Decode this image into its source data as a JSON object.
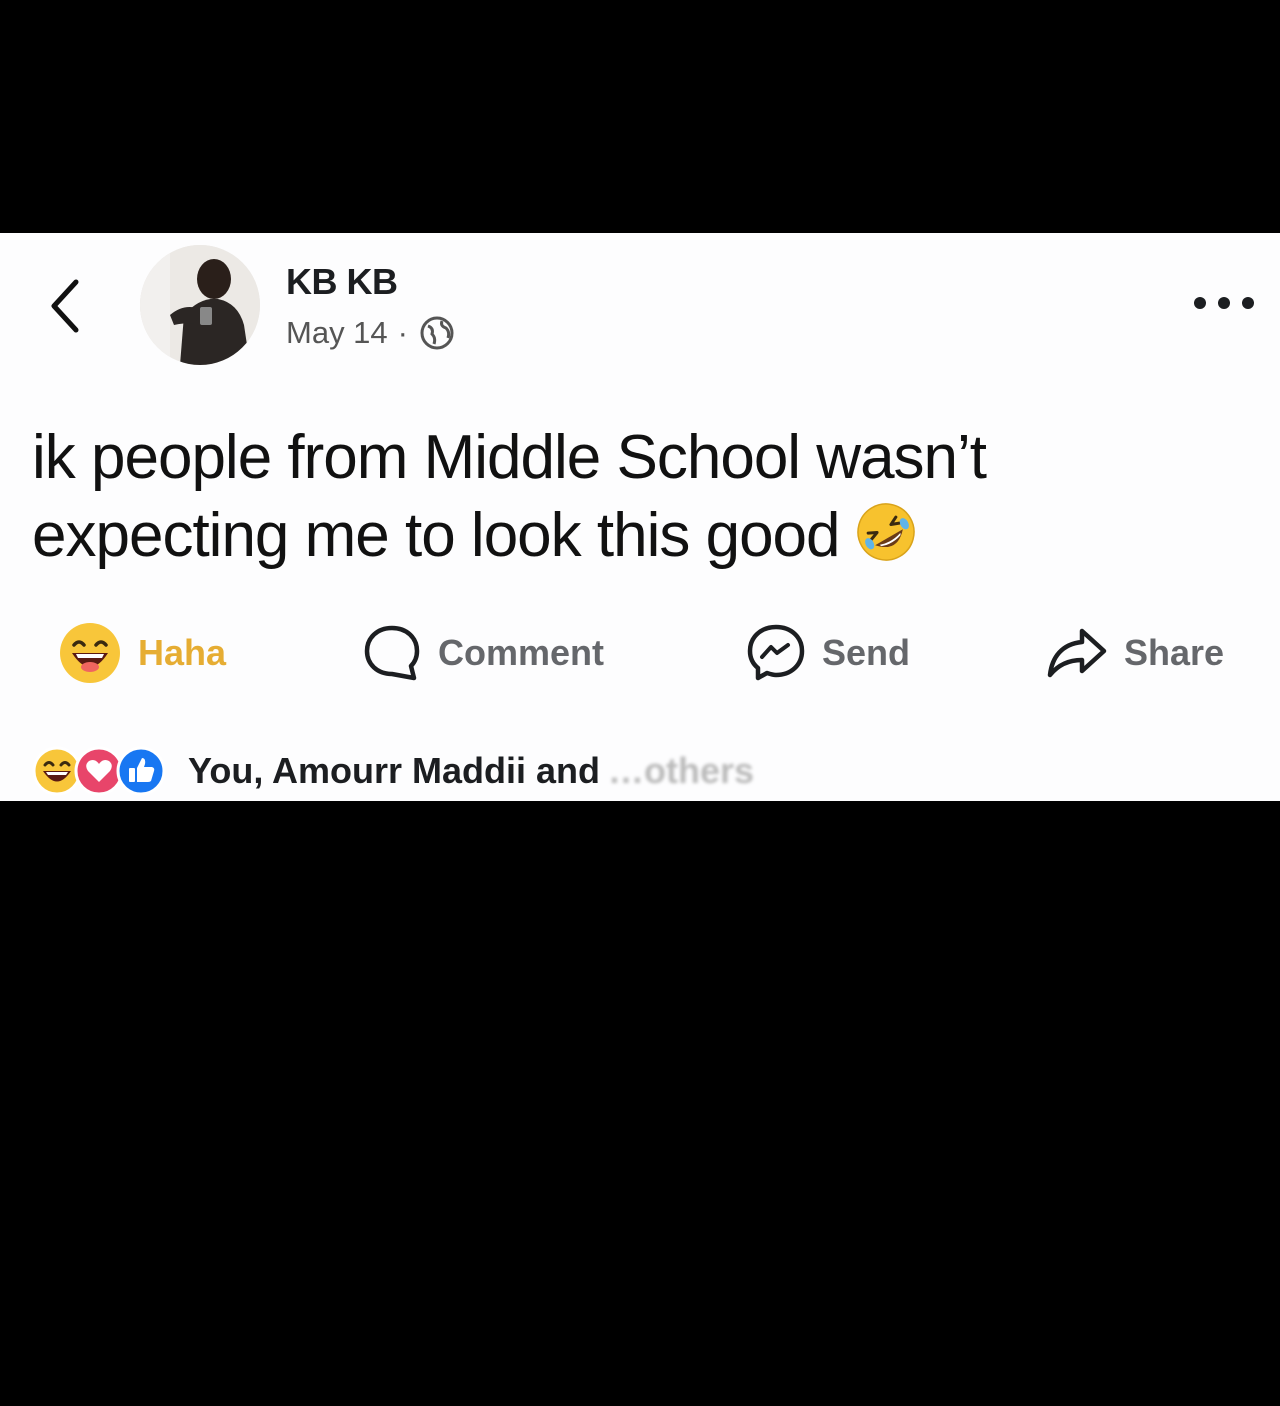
{
  "post": {
    "author": "KB KB",
    "date": "May 14",
    "separator": "·",
    "text": "ik people from Middle School wasn’t expecting me to look this good",
    "inline_emoji": "rolling-on-floor-laughing-emoji"
  },
  "actions": {
    "haha": "Haha",
    "comment": "Comment",
    "send": "Send",
    "share": "Share"
  },
  "reactions": {
    "summary": "You, Amourr Maddii and",
    "obscured": "…others",
    "icons": [
      "haha-icon",
      "love-icon",
      "like-icon"
    ]
  },
  "colors": {
    "haha": "#e6ad33",
    "love": "#e8456a",
    "like": "#1877f2"
  }
}
